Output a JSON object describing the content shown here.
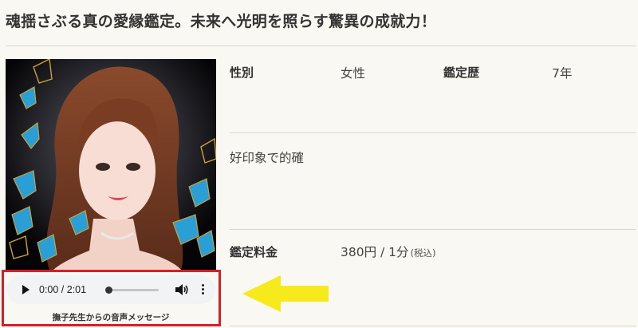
{
  "page_title": "魂揺さぶる真の愛縁鑑定。未来へ光明を照らす驚異の成就力！",
  "profile": {
    "gender_label": "性別",
    "gender_value": "女性",
    "experience_label": "鑑定歴",
    "experience_value": "7年",
    "impression": "好印象で的確",
    "fee_label": "鑑定料金",
    "fee_value": "380円 / 1分",
    "fee_tax": "(税込)"
  },
  "audio_player": {
    "time": "0:00 / 2:01",
    "progress": 0,
    "caption": "撫子先生からの音声メッセージ"
  },
  "colors": {
    "background": "#faf8f2",
    "highlight_box": "#d4202a",
    "arrow": "#f6ea1c",
    "player_bg": "#f1f3f4"
  },
  "icons": [
    "play-icon",
    "volume-icon",
    "more-vert-icon",
    "arrow-left-icon"
  ]
}
